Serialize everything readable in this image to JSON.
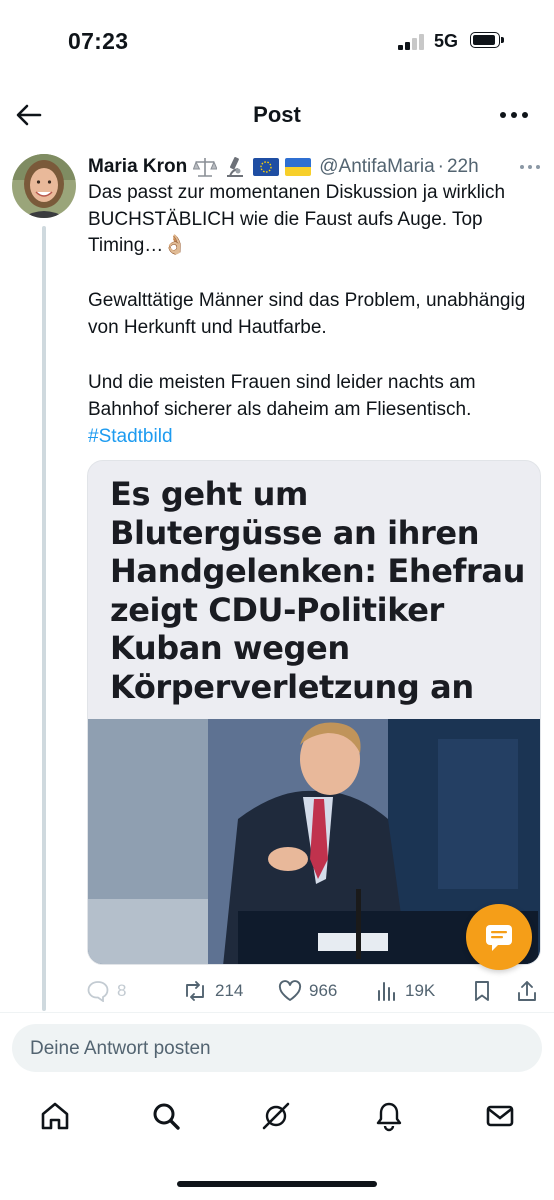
{
  "status_bar": {
    "time": "07:23",
    "network": "5G"
  },
  "header": {
    "title": "Post"
  },
  "tweet": {
    "author_name": "Maria Kron",
    "handle": "@AntifaMaria",
    "separator": "·",
    "time_ago": "22h",
    "paragraphs": [
      "Das passt zur momentanen Diskussion ja wirklich BUCHSTÄBLICH wie die Faust aufs Auge. Top Timing…👌🏼",
      "Gewalttätige Männer sind das Problem, unabhängig von Herkunft und Hautfarbe.",
      "Und die meisten Frauen sind leider nachts am Bahnhof sicherer als daheim am Fliesentisch."
    ],
    "hashtag": "#Stadtbild",
    "media_headline": "Es geht um Blutergüsse an ihren Handgelenken: Ehefrau zeigt CDU-Politiker Kuban wegen Körperverletzung an",
    "stats": {
      "replies": "8",
      "reposts": "214",
      "likes": "966",
      "views": "19K"
    }
  },
  "reply": {
    "placeholder": "Deine Antwort posten"
  },
  "colors": {
    "accent": "#1d9bf0",
    "fab": "#f59e18",
    "muted": "#536471"
  },
  "icons": [
    "back-arrow-icon",
    "more-icon",
    "reply-icon",
    "repost-icon",
    "like-icon",
    "views-icon",
    "bookmark-icon",
    "share-icon",
    "chat-icon",
    "home-icon",
    "search-icon",
    "grok-icon",
    "notifications-icon",
    "messages-icon"
  ]
}
